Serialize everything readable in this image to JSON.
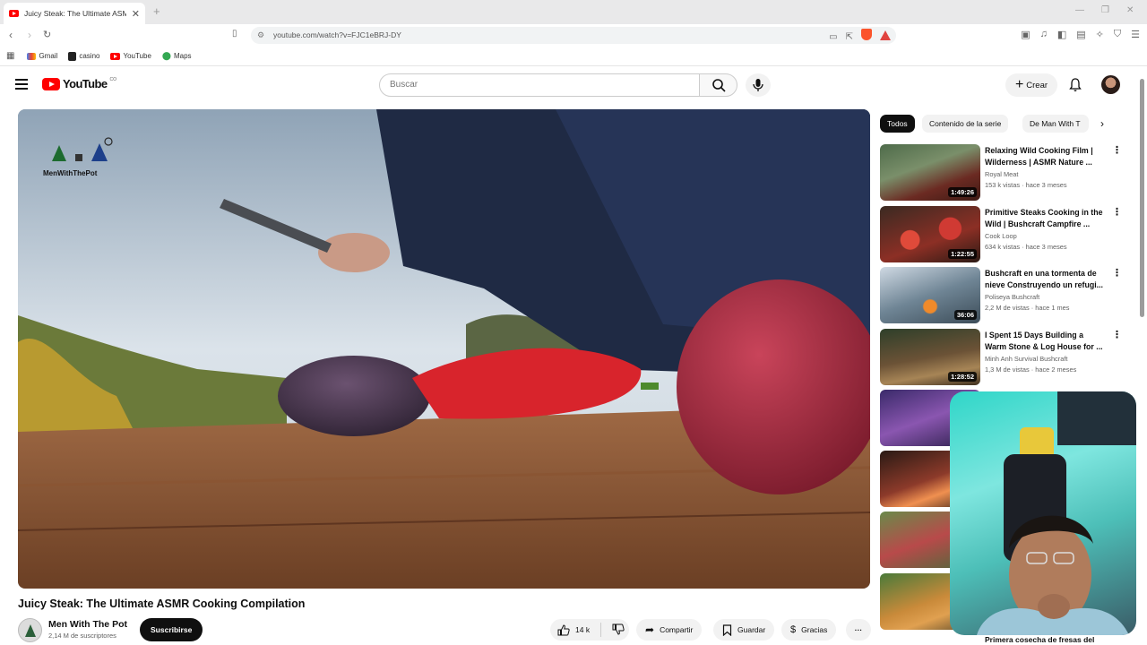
{
  "browser": {
    "tab_title": "Juicy Steak: The Ultimate ASMR",
    "url": "youtube.com/watch?v=FJC1eBRJ-DY",
    "bookmarks": [
      "Gmail",
      "casino",
      "YouTube",
      "Maps"
    ]
  },
  "header": {
    "search_placeholder": "Buscar",
    "create_label": "Crear",
    "country_code": "CO"
  },
  "video": {
    "title": "Juicy Steak: The Ultimate ASMR Cooking Compilation",
    "watermark": "MenWithThePot",
    "channel": "Men With The Pot",
    "subscribers": "2,14 M de suscriptores",
    "subscribe_label": "Suscribirse",
    "likes": "14 k",
    "share_label": "Compartir",
    "save_label": "Guardar",
    "thanks_label": "Gracias"
  },
  "chips": [
    "Todos",
    "Contenido de la serie",
    "De Man With T"
  ],
  "recommendations": [
    {
      "title": "Relaxing Wild Cooking Film | Wilderness | ASMR Nature ...",
      "channel": "Royal Meat",
      "meta": "153 k vistas · hace 3 meses",
      "duration": "1:49:26"
    },
    {
      "title": "Primitive Steaks Cooking in the Wild | Bushcraft Campfire ...",
      "channel": "Cook Loop",
      "meta": "634 k vistas · hace 3 meses",
      "duration": "1:22:55"
    },
    {
      "title": "Bushcraft en una tormenta de nieve Construyendo un refugi...",
      "channel": "Poliseya Bushcraft",
      "meta": "2,2 M de vistas · hace 1 mes",
      "duration": "36:06"
    },
    {
      "title": "I Spent 15 Days Building a Warm Stone & Log House for ...",
      "channel": "Minh Anh Survival Bushcraft",
      "meta": "1,3 M de vistas · hace 2 meses",
      "duration": "1:28:52"
    }
  ],
  "partial_rec_title": "Primera cosecha de fresas del"
}
